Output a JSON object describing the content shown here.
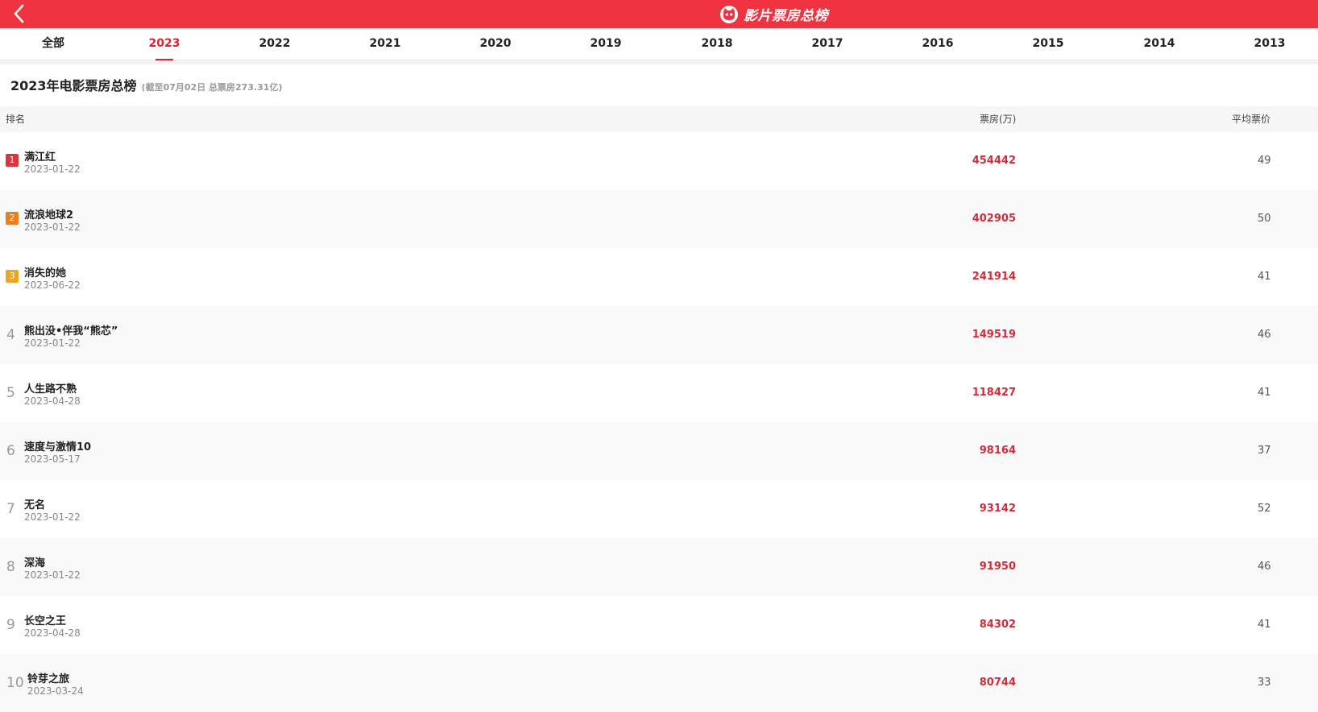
{
  "header": {
    "title": "影片票房总榜",
    "back_icon": "chevron-left-icon",
    "logo_icon": "maoyan-cat-logo-icon",
    "accent_color": "#ef3340"
  },
  "tabs": [
    "全部",
    "2023",
    "2022",
    "2021",
    "2020",
    "2019",
    "2018",
    "2017",
    "2016",
    "2015",
    "2014",
    "2013"
  ],
  "active_tab": "2023",
  "heading": {
    "title": "2023年电影票房总榜",
    "subtitle": "(截至07月02日 总票房273.31亿)"
  },
  "columns": {
    "rank": "排名",
    "box_office": "票房(万)",
    "avg_price": "平均票价"
  },
  "rank_colors": [
    "#d8353f",
    "#ea7d1f",
    "#e9a823"
  ],
  "movies": [
    {
      "rank": "1",
      "name": "满江红",
      "date": "2023-01-22",
      "box": "454442",
      "price": "49"
    },
    {
      "rank": "2",
      "name": "流浪地球2",
      "date": "2023-01-22",
      "box": "402905",
      "price": "50"
    },
    {
      "rank": "3",
      "name": "消失的她",
      "date": "2023-06-22",
      "box": "241914",
      "price": "41"
    },
    {
      "rank": "4",
      "name": "熊出没•伴我“熊芯”",
      "date": "2023-01-22",
      "box": "149519",
      "price": "46"
    },
    {
      "rank": "5",
      "name": "人生路不熟",
      "date": "2023-04-28",
      "box": "118427",
      "price": "41"
    },
    {
      "rank": "6",
      "name": "速度与激情10",
      "date": "2023-05-17",
      "box": "98164",
      "price": "37"
    },
    {
      "rank": "7",
      "name": "无名",
      "date": "2023-01-22",
      "box": "93142",
      "price": "52"
    },
    {
      "rank": "8",
      "name": "深海",
      "date": "2023-01-22",
      "box": "91950",
      "price": "46"
    },
    {
      "rank": "9",
      "name": "长空之王",
      "date": "2023-04-28",
      "box": "84302",
      "price": "41"
    },
    {
      "rank": "10",
      "name": "铃芽之旅",
      "date": "2023-03-24",
      "box": "80744",
      "price": "33"
    }
  ]
}
